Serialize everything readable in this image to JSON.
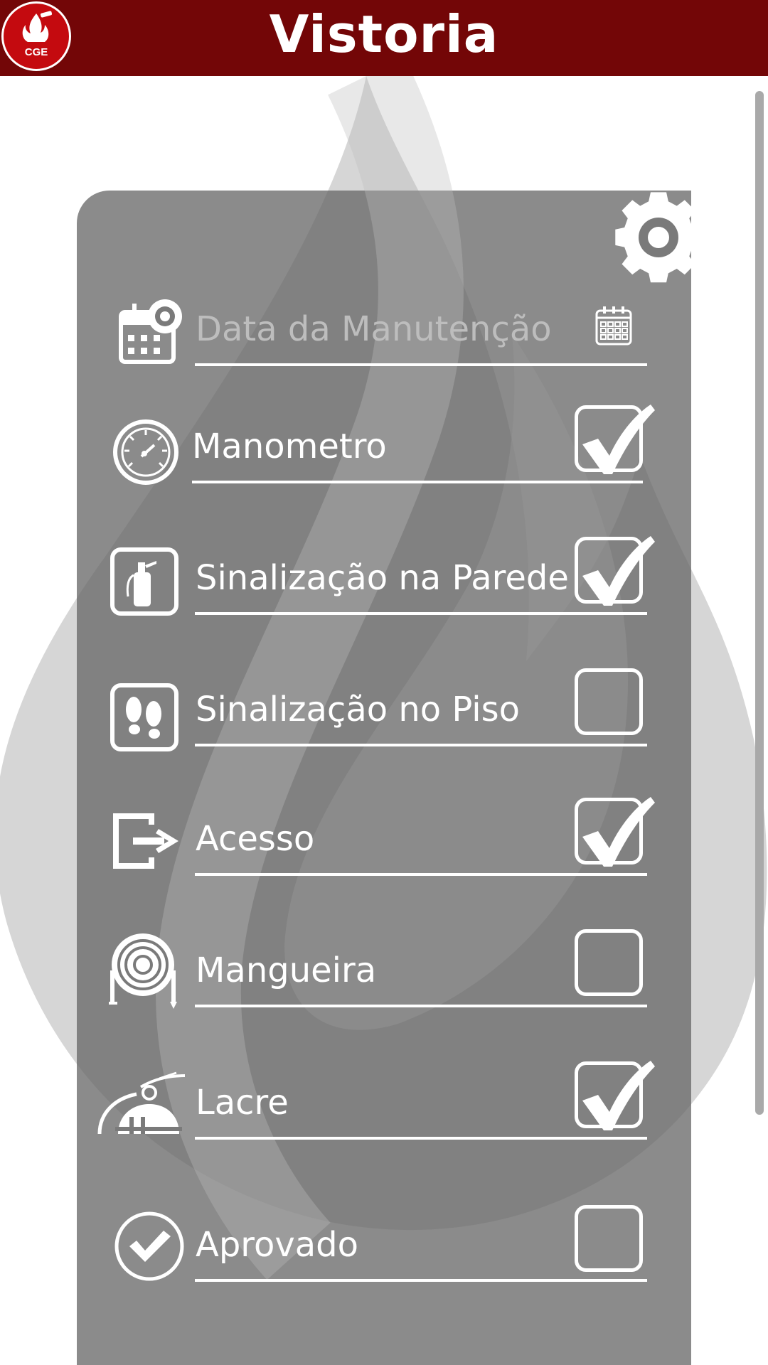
{
  "app": {
    "title": "Vistoria",
    "logo_text": "CGE"
  },
  "form": {
    "date_field": {
      "placeholder": "Data da Manutenção",
      "icon": "calendar-gear-icon",
      "picker_icon": "calendar-icon"
    },
    "items": [
      {
        "label": "Manometro",
        "icon": "pressure-gauge-icon",
        "checked": true
      },
      {
        "label": "Sinalização na Parede",
        "icon": "fire-extinguisher-sign-icon",
        "checked": true
      },
      {
        "label": "Sinalização no Piso",
        "icon": "footprints-sign-icon",
        "checked": false
      },
      {
        "label": "Acesso",
        "icon": "exit-arrow-icon",
        "checked": true
      },
      {
        "label": "Mangueira",
        "icon": "hose-reel-icon",
        "checked": false
      },
      {
        "label": "Lacre",
        "icon": "extinguisher-seal-icon",
        "checked": true
      },
      {
        "label": "Aprovado",
        "icon": "approved-check-icon",
        "checked": false
      }
    ]
  },
  "colors": {
    "header": "#730607",
    "logo": "#c40a0f",
    "panel": "#7a7a7a",
    "flame": "#d9d9d9"
  }
}
